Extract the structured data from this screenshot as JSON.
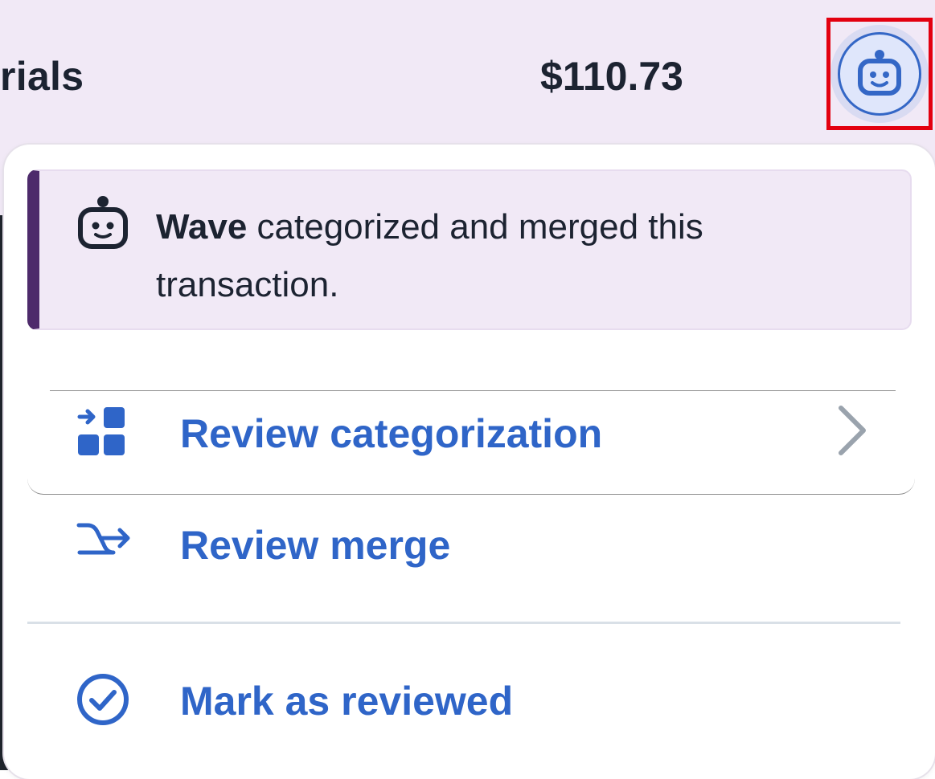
{
  "header": {
    "category_partial": "rials",
    "amount": "$110.73",
    "bot_button_icon": "robot-icon"
  },
  "popover": {
    "notice": {
      "icon": "robot-icon",
      "actor": "Wave",
      "message": " categorized and merged this transaction."
    },
    "items": [
      {
        "label": "Review categorization",
        "icon": "review-categorization-icon",
        "trailing_icon": "chevron-right-icon"
      },
      {
        "label": "Review merge",
        "icon": "merge-arrow-icon"
      },
      {
        "label": "Mark as reviewed",
        "icon": "check-circle-icon"
      }
    ]
  },
  "colors": {
    "accent": "#2f65c8",
    "header_bg": "#f1e9f6",
    "notice_border": "#4d2a6b",
    "highlight_box": "#e3000f"
  }
}
